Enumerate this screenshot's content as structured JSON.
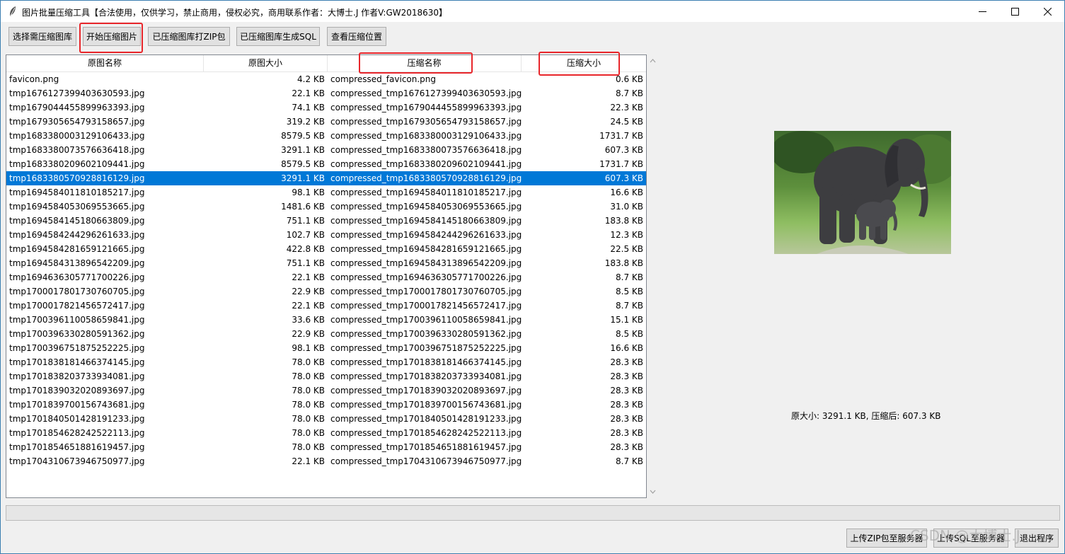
{
  "window": {
    "title": "图片批量压缩工具【合法使用，仅供学习，禁止商用，侵权必究，商用联系作者：大博士.J 作者V:GW2018630】",
    "controls": {
      "minimize": "—",
      "maximize": "☐",
      "close": "✕"
    }
  },
  "toolbar": {
    "select_label": "选择需压缩图库",
    "start_label": "开始压缩图片",
    "zip_label": "已压缩图库打ZIP包",
    "sql_label": "已压缩图库生成SQL",
    "view_label": "查看压缩位置"
  },
  "table": {
    "columns": [
      "原图名称",
      "原图大小",
      "压缩名称",
      "压缩大小"
    ],
    "rows": [
      [
        "favicon.png",
        "4.2 KB",
        "compressed_favicon.png",
        "0.6 KB"
      ],
      [
        "tmp1676127399403630593.jpg",
        "22.1 KB",
        "compressed_tmp1676127399403630593.jpg",
        "8.7 KB"
      ],
      [
        "tmp1679044455899963393.jpg",
        "74.1 KB",
        "compressed_tmp1679044455899963393.jpg",
        "22.3 KB"
      ],
      [
        "tmp1679305654793158657.jpg",
        "319.2 KB",
        "compressed_tmp1679305654793158657.jpg",
        "24.5 KB"
      ],
      [
        "tmp1683380003129106433.jpg",
        "8579.5 KB",
        "compressed_tmp1683380003129106433.jpg",
        "1731.7 KB"
      ],
      [
        "tmp1683380073576636418.jpg",
        "3291.1 KB",
        "compressed_tmp1683380073576636418.jpg",
        "607.3 KB"
      ],
      [
        "tmp1683380209602109441.jpg",
        "8579.5 KB",
        "compressed_tmp1683380209602109441.jpg",
        "1731.7 KB"
      ],
      [
        "tmp1683380570928816129.jpg",
        "3291.1 KB",
        "compressed_tmp1683380570928816129.jpg",
        "607.3 KB"
      ],
      [
        "tmp1694584011810185217.jpg",
        "98.1 KB",
        "compressed_tmp1694584011810185217.jpg",
        "16.6 KB"
      ],
      [
        "tmp1694584053069553665.jpg",
        "1481.6 KB",
        "compressed_tmp1694584053069553665.jpg",
        "31.0 KB"
      ],
      [
        "tmp1694584145180663809.jpg",
        "751.1 KB",
        "compressed_tmp1694584145180663809.jpg",
        "183.8 KB"
      ],
      [
        "tmp1694584244296261633.jpg",
        "102.7 KB",
        "compressed_tmp1694584244296261633.jpg",
        "12.3 KB"
      ],
      [
        "tmp1694584281659121665.jpg",
        "422.8 KB",
        "compressed_tmp1694584281659121665.jpg",
        "22.5 KB"
      ],
      [
        "tmp1694584313896542209.jpg",
        "751.1 KB",
        "compressed_tmp1694584313896542209.jpg",
        "183.8 KB"
      ],
      [
        "tmp1694636305771700226.jpg",
        "22.1 KB",
        "compressed_tmp1694636305771700226.jpg",
        "8.7 KB"
      ],
      [
        "tmp1700017801730760705.jpg",
        "22.9 KB",
        "compressed_tmp1700017801730760705.jpg",
        "8.5 KB"
      ],
      [
        "tmp1700017821456572417.jpg",
        "22.1 KB",
        "compressed_tmp1700017821456572417.jpg",
        "8.7 KB"
      ],
      [
        "tmp1700396110058659841.jpg",
        "33.6 KB",
        "compressed_tmp1700396110058659841.jpg",
        "15.1 KB"
      ],
      [
        "tmp1700396330280591362.jpg",
        "22.9 KB",
        "compressed_tmp1700396330280591362.jpg",
        "8.5 KB"
      ],
      [
        "tmp1700396751875252225.jpg",
        "98.1 KB",
        "compressed_tmp1700396751875252225.jpg",
        "16.6 KB"
      ],
      [
        "tmp1701838181466374145.jpg",
        "78.0 KB",
        "compressed_tmp1701838181466374145.jpg",
        "28.3 KB"
      ],
      [
        "tmp1701838203733934081.jpg",
        "78.0 KB",
        "compressed_tmp1701838203733934081.jpg",
        "28.3 KB"
      ],
      [
        "tmp1701839032020893697.jpg",
        "78.0 KB",
        "compressed_tmp1701839032020893697.jpg",
        "28.3 KB"
      ],
      [
        "tmp1701839700156743681.jpg",
        "78.0 KB",
        "compressed_tmp1701839700156743681.jpg",
        "28.3 KB"
      ],
      [
        "tmp1701840501428191233.jpg",
        "78.0 KB",
        "compressed_tmp1701840501428191233.jpg",
        "28.3 KB"
      ],
      [
        "tmp1701854628242522113.jpg",
        "78.0 KB",
        "compressed_tmp1701854628242522113.jpg",
        "28.3 KB"
      ],
      [
        "tmp1701854651881619457.jpg",
        "78.0 KB",
        "compressed_tmp1701854651881619457.jpg",
        "28.3 KB"
      ],
      [
        "tmp1704310673946750977.jpg",
        "22.1 KB",
        "compressed_tmp1704310673946750977.jpg",
        "8.7 KB"
      ]
    ],
    "selected_index": 7
  },
  "preview": {
    "image": "elephant-photo",
    "info": "原大小: 3291.1 KB, 压缩后: 607.3 KB"
  },
  "bottom": {
    "upload_zip_label": "上传ZIP包至服务器",
    "upload_sql_label": "上传SQL至服务器",
    "exit_label": "退出程序"
  },
  "watermark": "CSDN @大博士.J",
  "colors": {
    "selection": "#0078d7",
    "highlight_box": "#e8262b"
  }
}
